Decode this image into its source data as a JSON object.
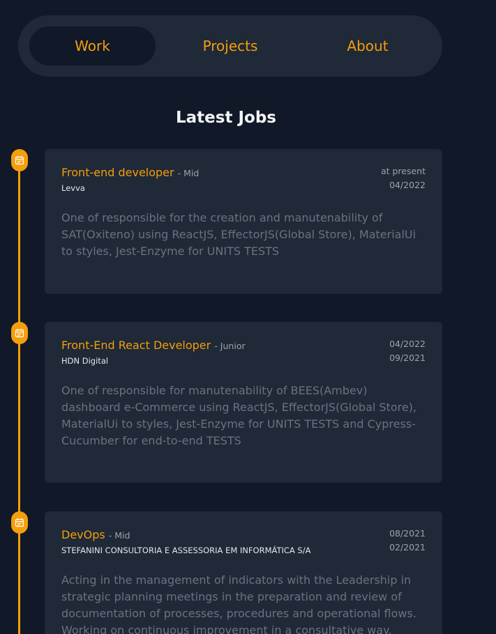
{
  "nav": {
    "tabs": [
      {
        "label": "Work",
        "active": true
      },
      {
        "label": "Projects",
        "active": false
      },
      {
        "label": "About",
        "active": false
      }
    ]
  },
  "section": {
    "title": "Latest Jobs"
  },
  "jobs": [
    {
      "title": "Front-end developer",
      "level": "- Mid",
      "company": "Levva",
      "date_end": "at present",
      "date_start": "04/2022",
      "description": "One of responsible for the creation and manutenability of SAT(Oxiteno) using ReactJS, EffectorJS(Global Store), MaterialUi to styles, Jest-Enzyme for UNITS TESTS"
    },
    {
      "title": "Front-End React Developer",
      "level": "- Junior",
      "company": "HDN Digital",
      "date_end": "04/2022",
      "date_start": "09/2021",
      "description": "One of responsible for manutenability of BEES(Ambev) dashboard e-Commerce using ReactJS, EffectorJS(Global Store), MaterialUi to styles, Jest-Enzyme for UNITS TESTS and Cypress-Cucumber for end-to-end TESTS"
    },
    {
      "title": "DevOps",
      "level": "- Mid",
      "company": "STEFANINI CONSULTORIA E ASSESSORIA EM INFORMÁTICA S/A",
      "date_end": "08/2021",
      "date_start": "02/2021",
      "description": "Acting in the management of indicators with the Leadership in strategic planning meetings in the preparation and review of documentation of processes, procedures and operational flows. Working on continuous improvement in a consultative way."
    }
  ],
  "colors": {
    "background": "#111827",
    "surface": "#1f2937",
    "accent": "#f59e0b",
    "muted_text": "#9ca3af",
    "description_text": "#6b7280"
  },
  "icons": {
    "timeline": "calendar-icon"
  }
}
